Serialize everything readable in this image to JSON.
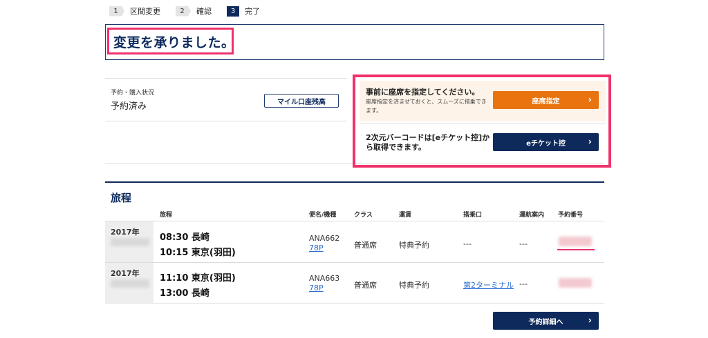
{
  "steps": [
    {
      "num": "1",
      "label": "区間変更"
    },
    {
      "num": "2",
      "label": "確認"
    },
    {
      "num": "3",
      "label": "完了"
    }
  ],
  "title": "変更を承りました。",
  "status": {
    "label": "予約・購入状況",
    "value": "予約済み",
    "mile_button": "マイル口座残高"
  },
  "promo_seat": {
    "title": "事前に座席を指定してください。",
    "subtitle": "座席指定を済ませておくと、スムーズに搭乗できます。",
    "button": "座席指定"
  },
  "promo_eticket": {
    "title": "2次元バーコードは[eチケット控]から取得できます。",
    "button": "eチケット控"
  },
  "itinerary": {
    "title": "旅程",
    "headers": {
      "itinerary": "旅程",
      "flight": "便名/機種",
      "class": "クラス",
      "fare": "運賃",
      "gate": "搭乗口",
      "info": "運航案内",
      "reservation": "予約番号"
    },
    "rows": [
      {
        "year": "2017年",
        "dep": "08:30 長崎",
        "arr": "10:15 東京(羽田)",
        "flight": "ANA662",
        "aircraft": "78P",
        "class": "普通席",
        "fare": "特典予約",
        "gate": "---",
        "info": "---"
      },
      {
        "year": "2017年",
        "dep": "11:10 東京(羽田)",
        "arr": "13:00 長崎",
        "flight": "ANA663",
        "aircraft": "78P",
        "class": "普通席",
        "fare": "特典予約",
        "gate": "第2ターミナル",
        "info": "---"
      }
    ],
    "detail_button": "予約詳細へ"
  },
  "icons": {
    "chevron": "chevron-right-icon"
  },
  "colors": {
    "navy": "#0e2a5c",
    "orange": "#e8730f",
    "highlight": "#f0316b",
    "link": "#2a6bd0"
  }
}
